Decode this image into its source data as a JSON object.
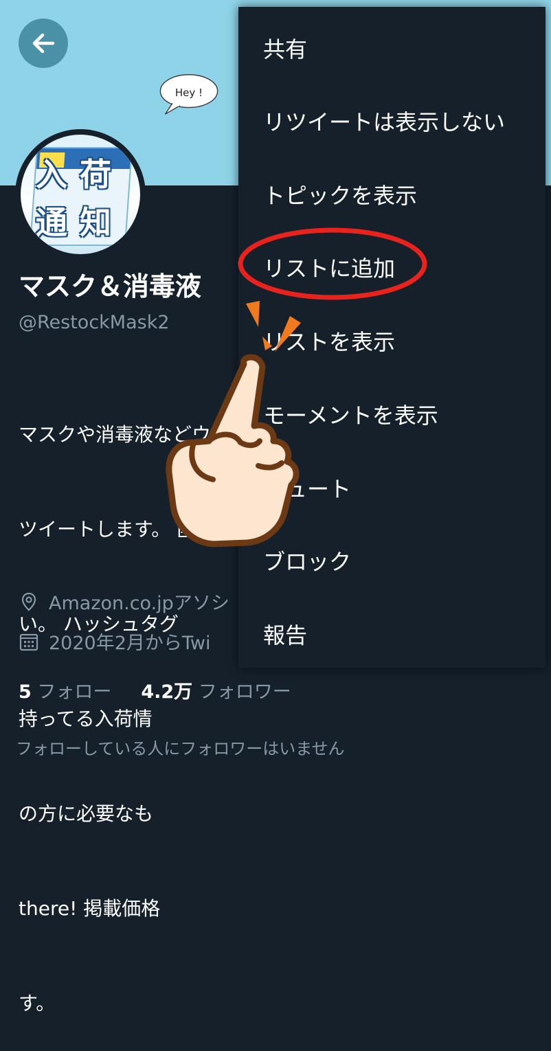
{
  "header": {
    "back_label": "back"
  },
  "banner": {
    "bubble_text": "Hey !"
  },
  "avatar": {
    "chars": [
      "入",
      "荷",
      "通",
      "知"
    ]
  },
  "profile": {
    "name": "マスク＆消毒液",
    "handle": "@RestockMask2",
    "bio_lines": [
      "マスクや消毒液などウ",
      "ツイートします。 匿",
      "い。 ハッシュタグ",
      "持ってる入荷情",
      "の方に必要なも",
      "there! 掲載価格",
      "す。"
    ],
    "location": "Amazon.co.jpアソシ",
    "joined": "2020年2月からTwi",
    "following_count": "5",
    "following_label": "フォロー",
    "followers_count": "4.2万",
    "followers_label": "フォロワー",
    "note": "フォローしている人にフォロワーはいません"
  },
  "menu": {
    "items": [
      "共有",
      "リツイートは表示しない",
      "トピックを表示",
      "リストに追加",
      "リストを表示",
      "モーメントを表示",
      "ミュート",
      "ブロック",
      "報告"
    ],
    "highlighted_index": 3
  },
  "colors": {
    "background": "#15202b",
    "banner": "#8fd3e8",
    "highlight_ring": "#e8231d",
    "hand_skin": "#fde6cf",
    "hand_outline": "#6b3a14",
    "accent_marks": "#f07a1c"
  }
}
